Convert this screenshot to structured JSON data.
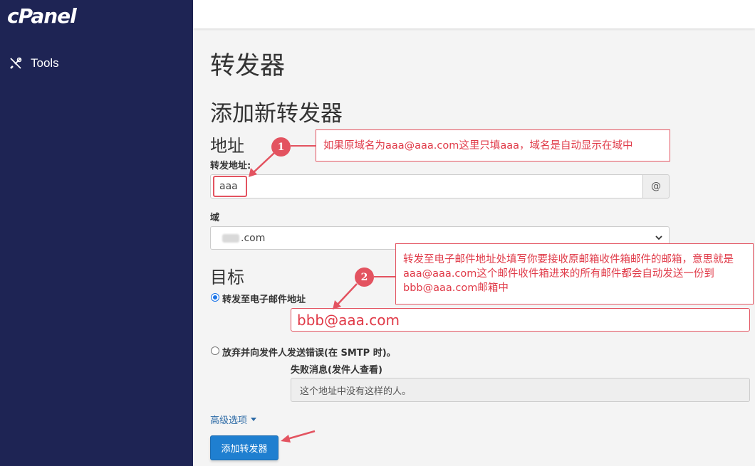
{
  "sidebar": {
    "logo": "cPanel",
    "items": [
      {
        "label": "Tools",
        "icon": "tools-icon"
      }
    ]
  },
  "page": {
    "title": "转发器",
    "subtitle": "添加新转发器"
  },
  "address": {
    "heading": "地址",
    "forward_label": "转发地址:",
    "forward_value": "aaa",
    "at_addon": "@",
    "domain_label": "域",
    "domain_value": ".com"
  },
  "destination": {
    "heading": "目标",
    "option_forward": "转发至电子邮件地址",
    "forward_to_value": "bbb@aaa.com",
    "option_discard": "放弃并向发件人发送错误(在 SMTP 时)。",
    "failure_label": "失败消息(发件人查看)",
    "failure_value": "这个地址中没有这样的人。"
  },
  "advanced_link": "高级选项",
  "submit_label": "添加转发器",
  "annotations": {
    "badge1": "1",
    "note1": "如果原域名为aaa@aaa.com这里只填aaa，域名是自动显示在域中",
    "badge2": "2",
    "note2": "转发至电子邮件地址处填写你要接收原邮箱收件箱邮件的邮箱，意思就是aaa@aaa.com这个邮件收件箱进来的所有邮件都会自动发送一份到bbb@aaa.com邮箱中"
  },
  "colors": {
    "sidebar_bg": "#1e2454",
    "accent": "#1f7fd0",
    "annotation": "#e35360"
  }
}
